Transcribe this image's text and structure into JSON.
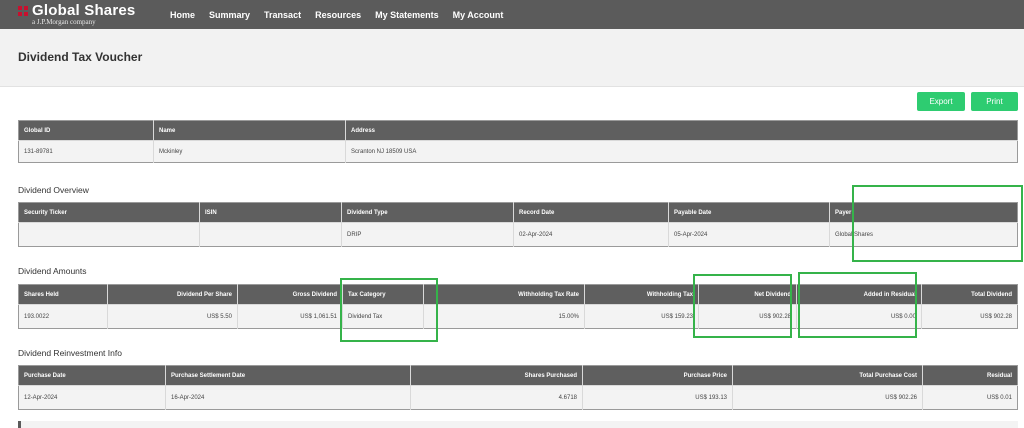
{
  "brand": {
    "name": "Global Shares",
    "sub": "a J.P.Morgan company"
  },
  "nav": [
    "Home",
    "Summary",
    "Transact",
    "Resources",
    "My Statements",
    "My Account"
  ],
  "page_title": "Dividend Tax Voucher",
  "buttons": {
    "export": "Export",
    "print": "Print"
  },
  "participant": {
    "headers": [
      "Global ID",
      "Name",
      "Address"
    ],
    "row": [
      "131-89781",
      "Mckinley",
      "Scranton NJ 18509 USA"
    ]
  },
  "overview": {
    "title": "Dividend Overview",
    "headers": [
      "Security Ticker",
      "ISIN",
      "Dividend Type",
      "Record Date",
      "Payable Date",
      "Payer"
    ],
    "row": [
      "",
      "",
      "DRIP",
      "02-Apr-2024",
      "05-Apr-2024",
      "Global Shares"
    ]
  },
  "amounts": {
    "title": "Dividend Amounts",
    "headers": [
      "Shares Held",
      "Dividend Per Share",
      "Gross Dividend",
      "Tax Category",
      "Withholding Tax Rate",
      "Withholding Tax",
      "Net Dividend",
      "Added in Residual",
      "Total Dividend"
    ],
    "row": [
      "193.0022",
      "US$ 5.50",
      "US$ 1,061.51",
      "Dividend Tax",
      "15.00%",
      "US$ 159.23",
      "US$ 902.28",
      "US$ 0.00",
      "US$ 902.28"
    ]
  },
  "reinvestment": {
    "title": "Dividend Reinvestment Info",
    "headers": [
      "Purchase Date",
      "Purchase Settlement Date",
      "Shares Purchased",
      "Purchase Price",
      "Total Purchase Cost",
      "Residual"
    ],
    "row": [
      "12-Apr-2024",
      "16-Apr-2024",
      "4.6718",
      "US$ 193.13",
      "US$ 902.26",
      "US$ 0.01"
    ]
  },
  "colors": {
    "nav_bg": "#5b5b5b",
    "header_bg": "#5f5f5f",
    "button": "#2ecc71",
    "highlight": "#35b34a"
  }
}
